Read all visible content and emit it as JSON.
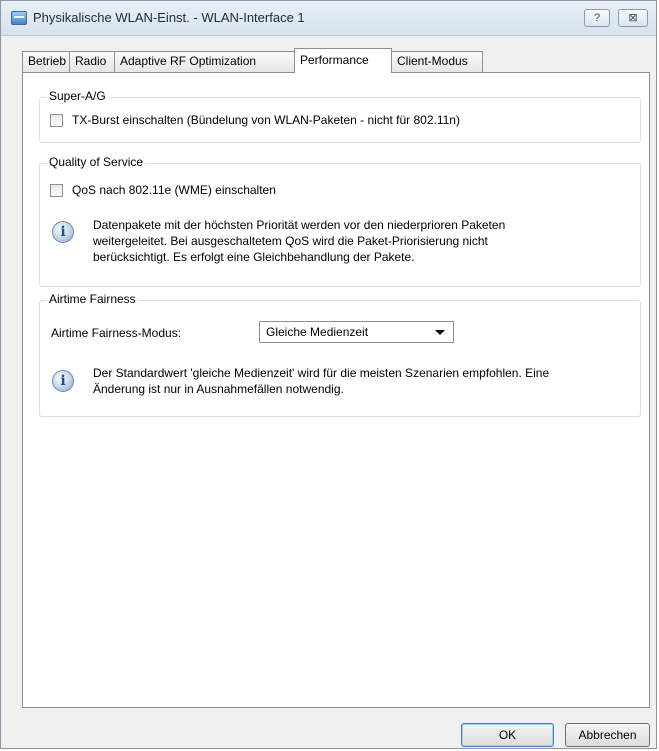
{
  "window": {
    "title": "Physikalische WLAN-Einst. - WLAN-Interface 1",
    "help_label": "?",
    "close_label": "⊠",
    "app_icon": "window-icon"
  },
  "tabs": [
    {
      "label": "Betrieb",
      "active": false
    },
    {
      "label": "Radio",
      "active": false
    },
    {
      "label": "Adaptive RF Optimization",
      "active": false
    },
    {
      "label": "Performance",
      "active": true
    },
    {
      "label": "Client-Modus",
      "active": false
    }
  ],
  "super_ag": {
    "title": "Super-A/G",
    "txburst_label": "TX-Burst einschalten (Bündelung von WLAN-Paketen - nicht für 802.11n)",
    "txburst_checked": false
  },
  "qos": {
    "title": "Quality of Service",
    "wme_label": "QoS nach 802.11e (WME) einschalten",
    "wme_checked": false,
    "info_icon": "info-icon",
    "info_line1": "Datenpakete mit der höchsten Priorität werden vor den niederprioren Paketen",
    "info_line2": "weitergeleitet. Bei ausgeschaltetem QoS wird die Paket-Priorisierung nicht",
    "info_line3": "berücksichtigt. Es erfolgt eine Gleichbehandlung der Pakete."
  },
  "airtime": {
    "title": "Airtime Fairness",
    "mode_label": "Airtime Fairness-Modus:",
    "mode_value": "Gleiche Medienzeit",
    "info_icon": "info-icon",
    "info_line1": "Der Standardwert 'gleiche Medienzeit' wird für die meisten Szenarien empfohlen. Eine",
    "info_line2": "Änderung ist nur in Ausnahmefällen notwendig."
  },
  "buttons": {
    "ok": "OK",
    "cancel": "Abbrechen"
  }
}
